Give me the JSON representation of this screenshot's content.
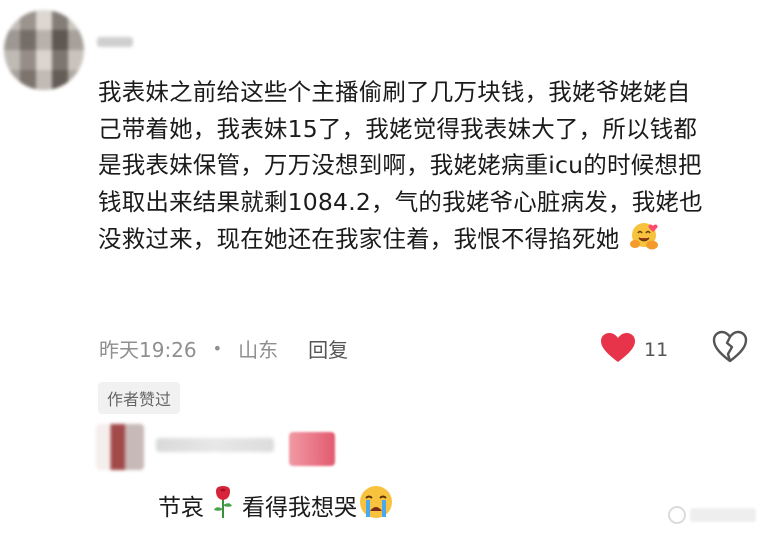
{
  "comment": {
    "lines": [
      "我表妹之前给这些个主播偷刷了几万块钱，我姥爷姥姥自",
      "己带着她，我表妹15了，我姥觉得我表妹大了，所以钱都",
      "是我表妹保管，万万没想到啊，我姥姥病重icu的时候想把",
      "钱取出来结果就剩1084.2，气的我姥爷心脏病发，我姥也",
      "没救过来，现在她还在我家住着，我恨不得掐死她"
    ],
    "trailing_emoji": "smiling-face-with-hearts-hug-icon",
    "time": "昨天19:26",
    "separator": "•",
    "location": "山东",
    "reply_label": "回复",
    "like_count": "11",
    "author_liked_badge": "作者赞过"
  },
  "reply": {
    "text_before": "节哀",
    "rose_icon": "rose-icon",
    "text_after": "看得我想哭",
    "crying_icon": "crying-face-icon"
  },
  "colors": {
    "like_red": "#e8344a",
    "meta_gray": "#8f8f8f",
    "badge_bg": "#f1f1f1"
  }
}
